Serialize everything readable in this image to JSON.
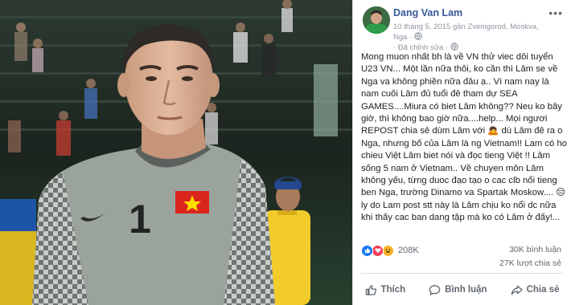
{
  "post": {
    "author": "Dang Van Lam",
    "meta_line1": "10 tháng 5, 2015 gần Zvenigorod, Moskva, Nga · ",
    "meta_line2": "· Đã chỉnh sửa · ",
    "text": "Mong muon nhất bh là về VN thử viec dôi tuyển U23 VN... Một lần nữa thôi, ko cần thì Lâm se về Nga va không phiền nữa đâu ạ.. Vì nam nay là nam cuối Lâm đủ tuổi đê tham dự SEA GAMES....Miura có biet Lâm không?? Neu ko bây giờ, thì không bao giờ nữa....help... Mọi ngươi REPOST chia sẻ dùm Lâm với 🙇 dù Lâm đê ra o Nga, nhưng bố của Lâm là ng Vietnam!! Lam có ho chieu Việt Lâm biet nói và đọc tieng Việt !! Lâm sống 5 nam ở Vietnam.. Về chuyen môn Lâm không yếu, từng duoc đạo tạo o cac clb nổi tieng ben Nga, trường Dinamo va Spartak Moskow.... 😔 ly do Lam post stt này là Lâm chịu ko nổi dc nữa khi thấy cac ban dang tập mà ko có Lâm ở đấy!..."
  },
  "reactions": {
    "count": "208K",
    "icons": [
      "like-icon",
      "love-icon",
      "haha-icon"
    ],
    "comments": "30K bình luận",
    "shares": "27K lượt chia sẻ"
  },
  "actions": {
    "like": "Thích",
    "comment": "Bình luận",
    "share": "Chia sẻ"
  },
  "photo": {
    "jersey_number": "1"
  },
  "colors": {
    "author_blue": "#385898",
    "like_blue": "#1877f2",
    "love_red": "#f33e58",
    "haha_yellow": "#f7b125",
    "jersey_gray": "#9aa39c",
    "flag_red": "#da251d",
    "flag_star": "#ffde00"
  }
}
